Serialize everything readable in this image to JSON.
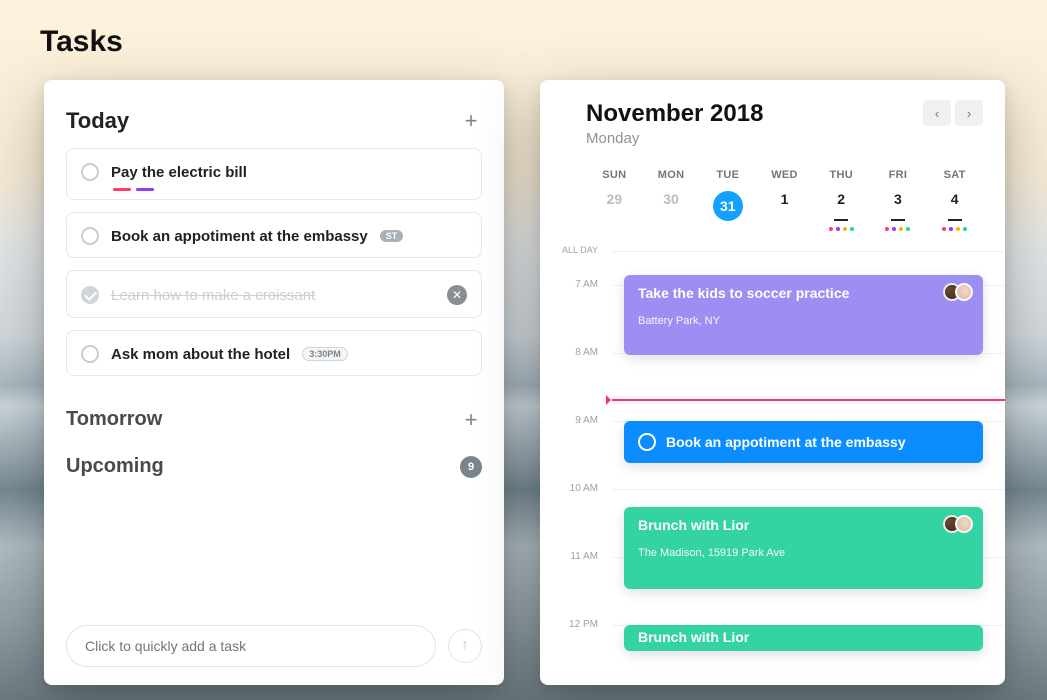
{
  "pageTitle": "Tasks",
  "tasks": {
    "today": {
      "label": "Today",
      "items": {
        "electric": {
          "title": "Pay the electric bill",
          "tagColors": [
            "#ff3b6e",
            "#8a3cff"
          ]
        },
        "embassy": {
          "title": "Book an appotiment at the embassy",
          "badge": "ST"
        },
        "croissant": {
          "title": "Learn how to make a croissant"
        },
        "hotel": {
          "title": "Ask mom about the hotel",
          "pill": "3:30PM"
        }
      }
    },
    "tomorrow": {
      "label": "Tomorrow"
    },
    "upcoming": {
      "label": "Upcoming",
      "count": "9"
    }
  },
  "quickAdd": {
    "placeholder": "Click to quickly add a task"
  },
  "calendar": {
    "month": "November 2018",
    "day": "Monday",
    "dow": [
      "SUN",
      "MON",
      "TUE",
      "WED",
      "THU",
      "FRI",
      "SAT"
    ],
    "dates": {
      "d0": "29",
      "d1": "30",
      "d2": "31",
      "d3": "1",
      "d4": "2",
      "d5": "3",
      "d6": "4"
    },
    "dateDots": {
      "d4": [
        "#ff3b6e",
        "#8a3cff",
        "#ffb400",
        "#27d39b"
      ],
      "d5": [
        "#ff3b6e",
        "#8a3cff",
        "#ffb400",
        "#27d39b"
      ],
      "d6": [
        "#ff3b6e",
        "#8a3cff",
        "#ffb400",
        "#27d39b"
      ]
    },
    "allDayLabel": "ALL DAY",
    "hours": {
      "h7": "7 AM",
      "h8": "8 AM",
      "h9": "9 AM",
      "h10": "10 AM",
      "h11": "11 AM",
      "h12": "12 PM"
    },
    "events": {
      "soccer": {
        "title": "Take the kids to soccer practice",
        "loc": "Battery Park, NY",
        "color": "#9c8ef2"
      },
      "embassy": {
        "title": "Book an appotiment at the embassy",
        "color": "#0b8dff"
      },
      "brunch1": {
        "title": "Brunch with Lior",
        "loc": "The Madison, 15919 Park Ave",
        "color": "#33d3a3"
      },
      "brunch2": {
        "title": "Brunch with Lior",
        "color": "#33d3a3"
      }
    }
  }
}
